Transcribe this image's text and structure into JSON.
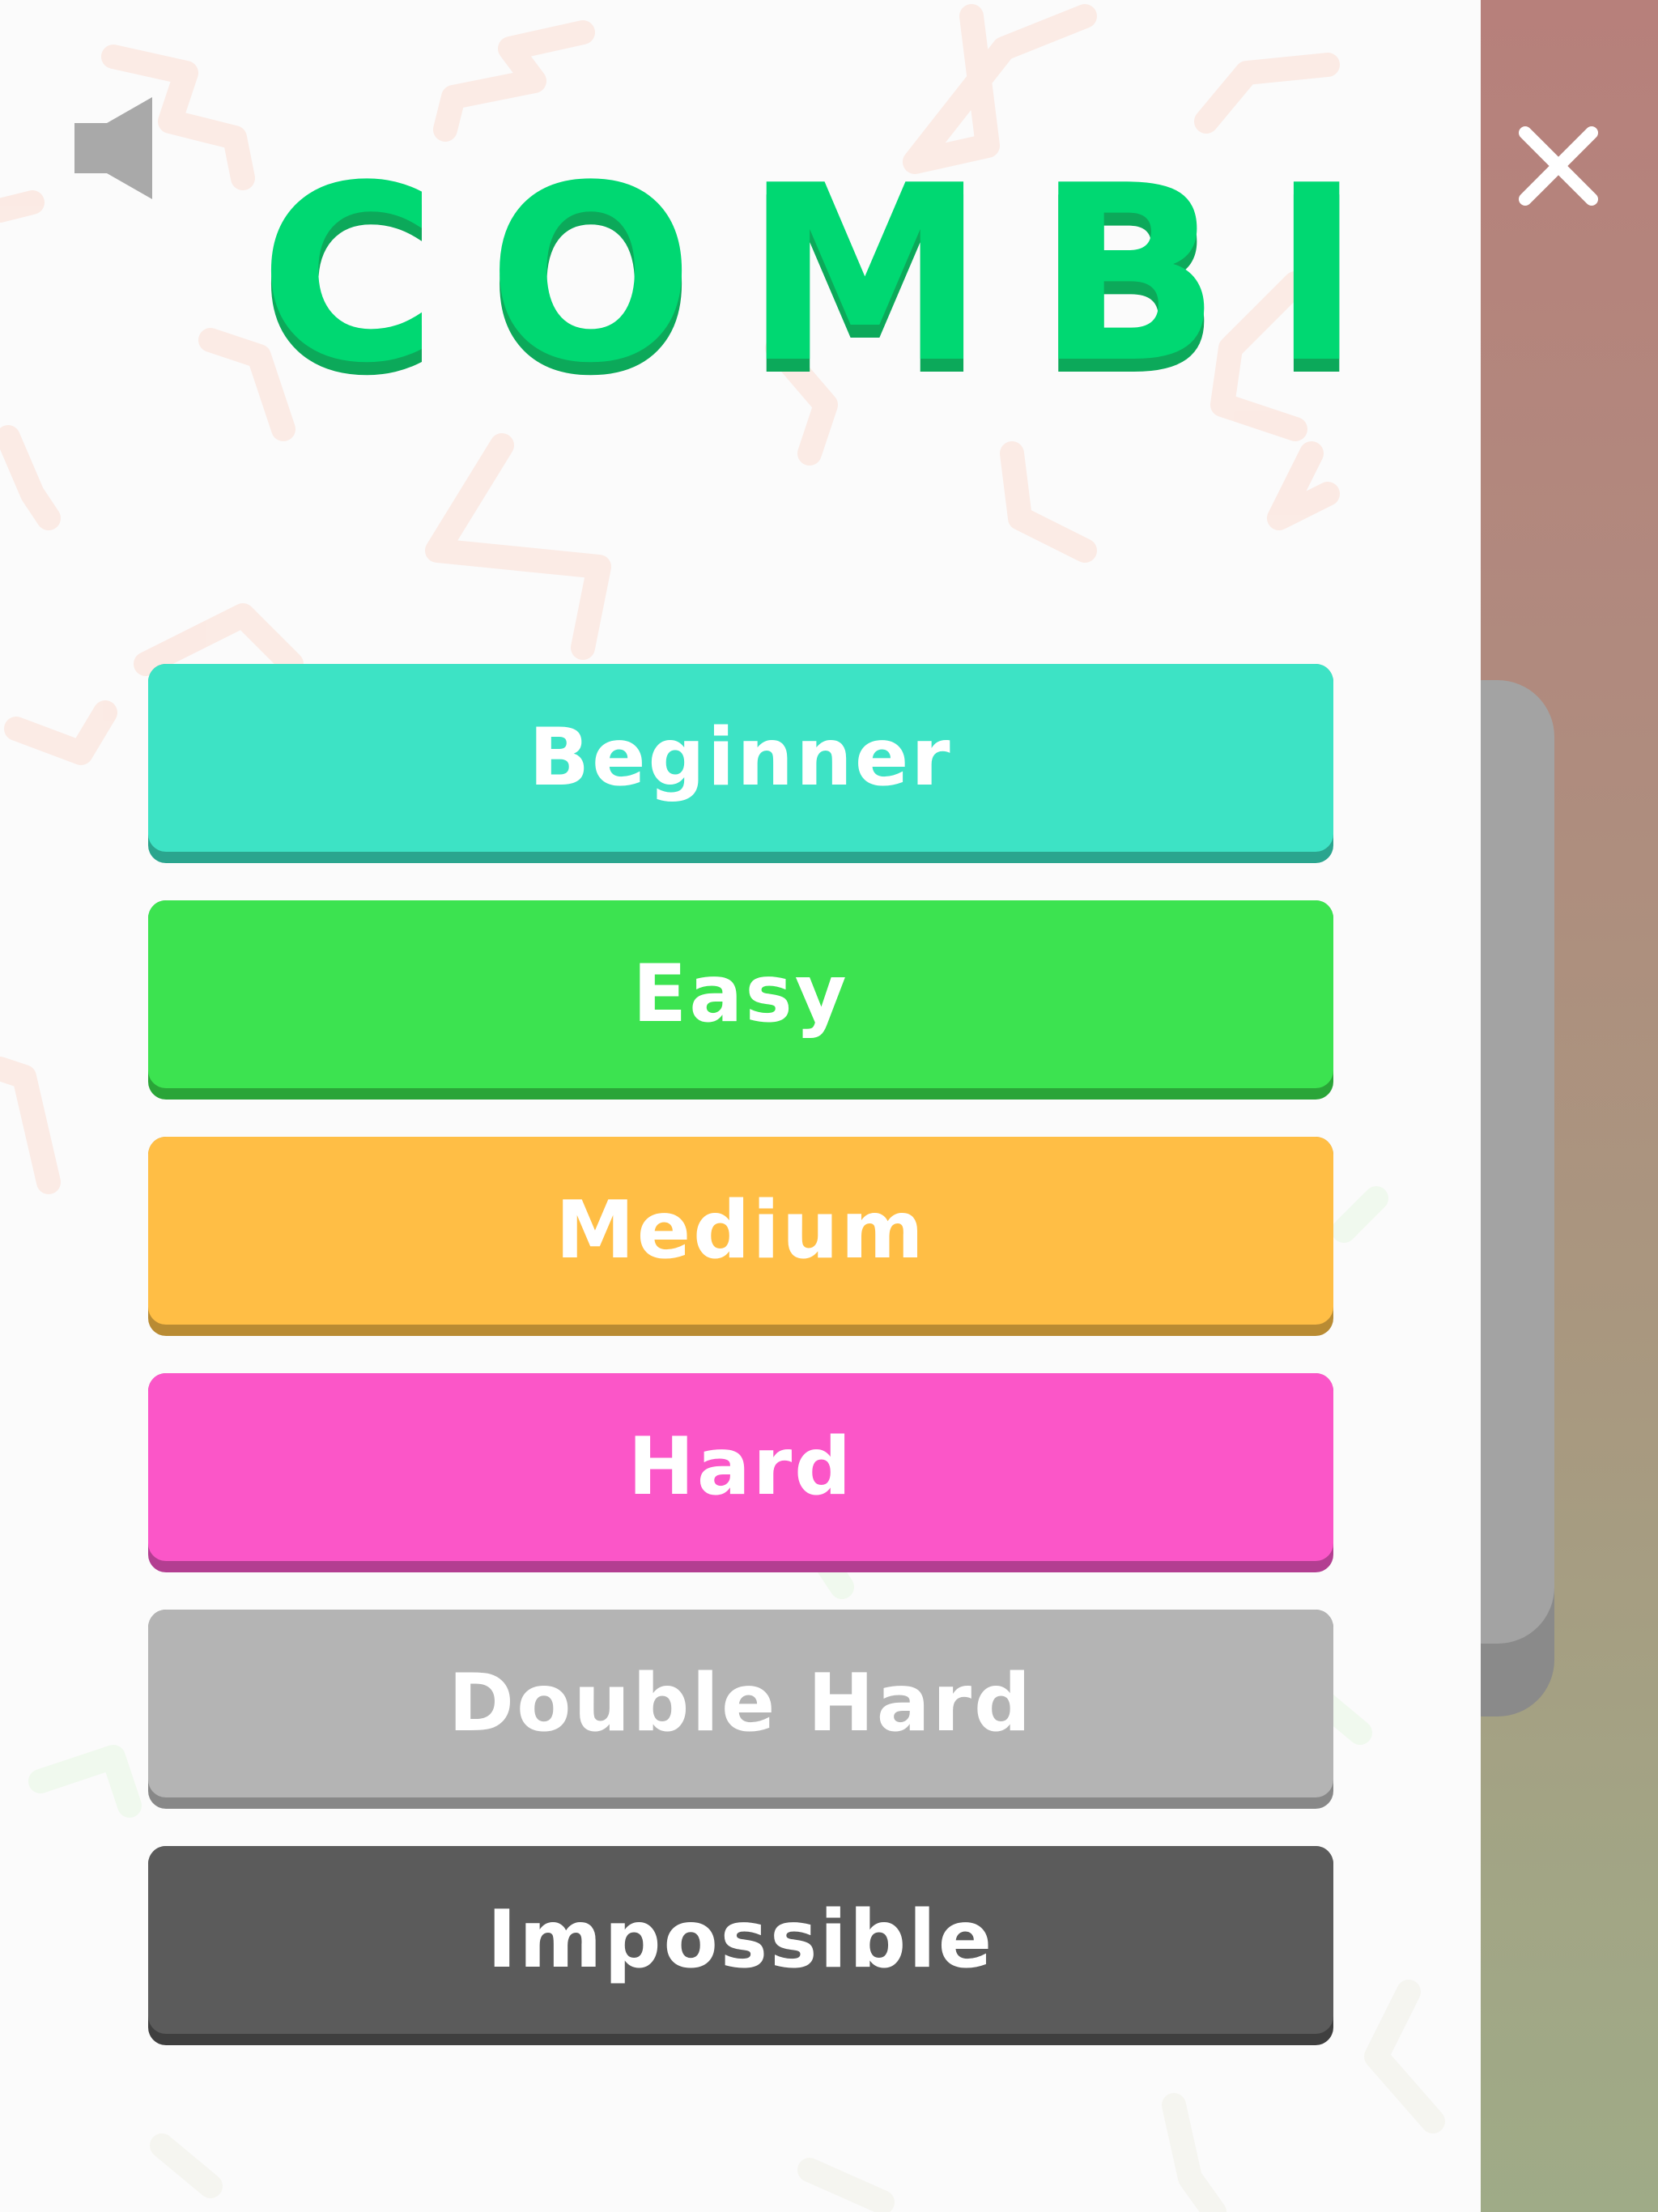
{
  "game": {
    "title": "COMBI",
    "colors": {
      "title": "#00d872",
      "title_shadow": "#0ca95a"
    }
  },
  "controls": {
    "sound_icon": "speaker-icon",
    "close_icon": "close-icon"
  },
  "levels": [
    {
      "label": "Beginner",
      "color": "#3de3c5",
      "shadow": "#2aa58e"
    },
    {
      "label": "Easy",
      "color": "#3ce350",
      "shadow": "#2aa538"
    },
    {
      "label": "Medium",
      "color": "#ffbe45",
      "shadow": "#b98b33"
    },
    {
      "label": "Hard",
      "color": "#fb56c8",
      "shadow": "#b33e91"
    },
    {
      "label": "Double Hard",
      "color": "#b4b4b4",
      "shadow": "#888888"
    },
    {
      "label": "Impossible",
      "color": "#5b5b5b",
      "shadow": "#3f3f3f"
    }
  ]
}
